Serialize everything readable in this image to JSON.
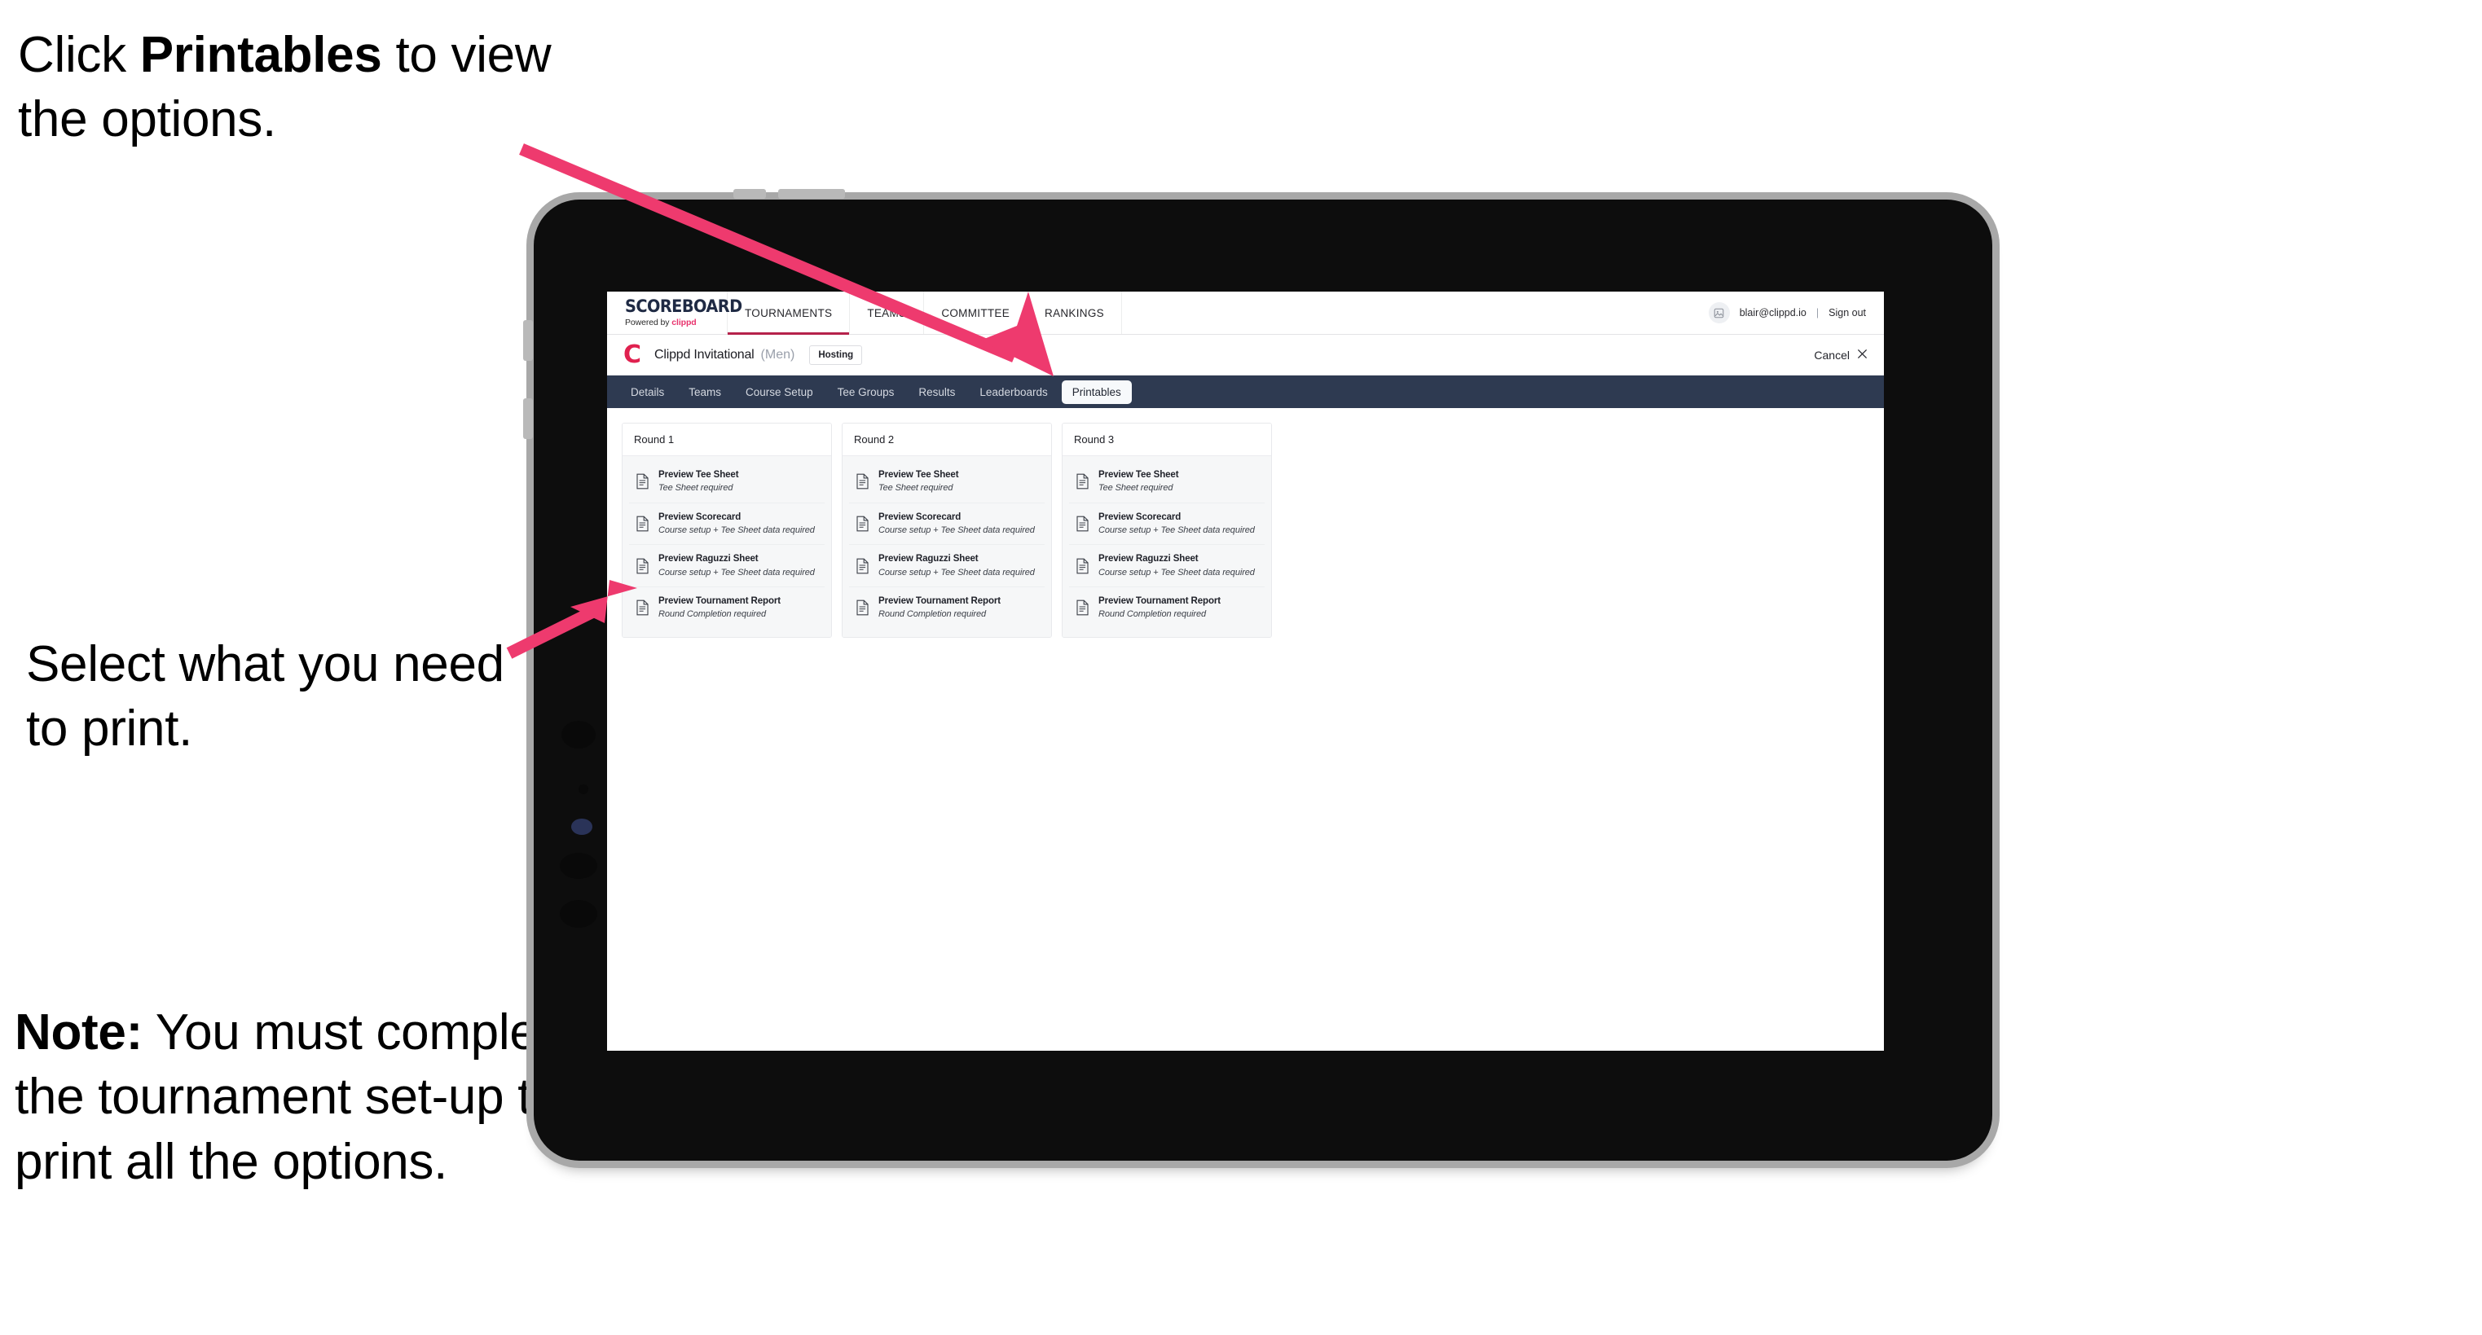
{
  "annotations": {
    "top": {
      "prefix": "Click ",
      "bold": "Printables",
      "suffix": " to view the options."
    },
    "middle": {
      "text": "Select what you need to print."
    },
    "note": {
      "bold": "Note:",
      "text": " You must complete the tournament set-up to print all the options."
    }
  },
  "colors": {
    "accent_pink": "#e8336d",
    "brand_red": "#e0214f",
    "tab_strip": "#2e3a51",
    "arrow": "#ee3a6e",
    "active_underline": "#b5224b"
  },
  "app": {
    "brand": {
      "title": "SCOREBOARD",
      "powered_prefix": "Powered by ",
      "powered_brand": "clippd"
    },
    "topnav": [
      {
        "label": "TOURNAMENTS",
        "active": true
      },
      {
        "label": "TEAMS",
        "active": false
      },
      {
        "label": "COMMITTEE",
        "active": false
      },
      {
        "label": "RANKINGS",
        "active": false
      }
    ],
    "account": {
      "avatar_icon": "user-avatar-icon",
      "email": "blair@clippd.io",
      "separator": "|",
      "sign_out": "Sign out"
    },
    "tournament": {
      "logo_letter": "C",
      "name": "Clippd Invitational",
      "gender": "(Men)",
      "badge": "Hosting",
      "cancel_label": "Cancel",
      "cancel_icon": "close-icon"
    },
    "tabs": [
      {
        "label": "Details",
        "active": false
      },
      {
        "label": "Teams",
        "active": false
      },
      {
        "label": "Course Setup",
        "active": false
      },
      {
        "label": "Tee Groups",
        "active": false
      },
      {
        "label": "Results",
        "active": false
      },
      {
        "label": "Leaderboards",
        "active": false
      },
      {
        "label": "Printables",
        "active": true
      }
    ],
    "rounds": [
      {
        "title": "Round 1",
        "items": [
          {
            "title": "Preview Tee Sheet",
            "subtitle": "Tee Sheet required",
            "icon": "document-icon"
          },
          {
            "title": "Preview Scorecard",
            "subtitle": "Course setup + Tee Sheet data required",
            "icon": "document-icon"
          },
          {
            "title": "Preview Raguzzi Sheet",
            "subtitle": "Course setup + Tee Sheet data required",
            "icon": "document-icon"
          },
          {
            "title": "Preview Tournament Report",
            "subtitle": "Round Completion required",
            "icon": "document-icon"
          }
        ]
      },
      {
        "title": "Round 2",
        "items": [
          {
            "title": "Preview Tee Sheet",
            "subtitle": "Tee Sheet required",
            "icon": "document-icon"
          },
          {
            "title": "Preview Scorecard",
            "subtitle": "Course setup + Tee Sheet data required",
            "icon": "document-icon"
          },
          {
            "title": "Preview Raguzzi Sheet",
            "subtitle": "Course setup + Tee Sheet data required",
            "icon": "document-icon"
          },
          {
            "title": "Preview Tournament Report",
            "subtitle": "Round Completion required",
            "icon": "document-icon"
          }
        ]
      },
      {
        "title": "Round 3",
        "items": [
          {
            "title": "Preview Tee Sheet",
            "subtitle": "Tee Sheet required",
            "icon": "document-icon"
          },
          {
            "title": "Preview Scorecard",
            "subtitle": "Course setup + Tee Sheet data required",
            "icon": "document-icon"
          },
          {
            "title": "Preview Raguzzi Sheet",
            "subtitle": "Course setup + Tee Sheet data required",
            "icon": "document-icon"
          },
          {
            "title": "Preview Tournament Report",
            "subtitle": "Round Completion required",
            "icon": "document-icon"
          }
        ]
      }
    ]
  }
}
